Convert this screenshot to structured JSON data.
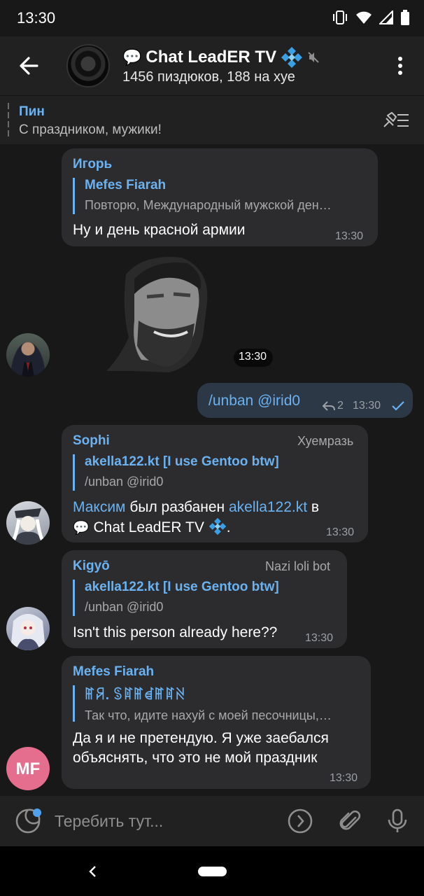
{
  "status_bar": {
    "time": "13:30"
  },
  "header": {
    "title": "Chat LeadER TV",
    "title_emoji_left": "💬",
    "subtitle": "1456 пиздюков, 188 на хуе",
    "icons": [
      "back-arrow-icon",
      "chat-avatar",
      "diamond-icon",
      "muted-icon",
      "more-vertical-icon"
    ]
  },
  "pinned": {
    "label": "Пин",
    "text": "С праздником, мужики!"
  },
  "messages": [
    {
      "sender": "Игорь",
      "reply_name": "Mefes Fiarah",
      "reply_text": "Повторю, Международный мужской ден…",
      "text": "Ну и день красной армии",
      "time": "13:30"
    },
    {
      "type": "sticker",
      "time": "13:30"
    },
    {
      "outgoing": true,
      "text": "/unban @irid0",
      "replies": "2",
      "time": "13:30"
    },
    {
      "sender": "Sophi",
      "badge": "Хуемразь",
      "reply_name": "akella122.kt [I use Gentoo btw]",
      "reply_text": "/unban @irid0",
      "text_parts": [
        "Максим",
        " был разбанен ",
        "akella122.kt",
        " в"
      ],
      "text_line2": "Chat LeadER TV",
      "time": "13:30"
    },
    {
      "sender": "Kigyō",
      "badge": "Nazi loli bot",
      "reply_name": "akella122.kt [I use Gentoo btw]",
      "reply_text": "/unban @irid0",
      "text": "Isn't this person already here??",
      "time": "13:30"
    },
    {
      "sender": "Mefes Fiarah",
      "reply_name": "ꂵꋪ. ꌗꍏꂵꀸꂵꍏꋊ",
      "reply_text": "Так что, идите нахуй с моей песочницы,…",
      "text_line1": "Да я и не претендую. Я уже заебался",
      "text_line2": "объяснять, что это не мой праздник",
      "time": "13:30",
      "avatar_initials": "MF"
    }
  ],
  "input": {
    "placeholder": "Теребить тут..."
  },
  "colors": {
    "accent": "#6ab2f2",
    "bubble": "#2c2c2e",
    "outgoing_bubble": "#2c3846",
    "avatar_mf": "#e56d8e"
  }
}
